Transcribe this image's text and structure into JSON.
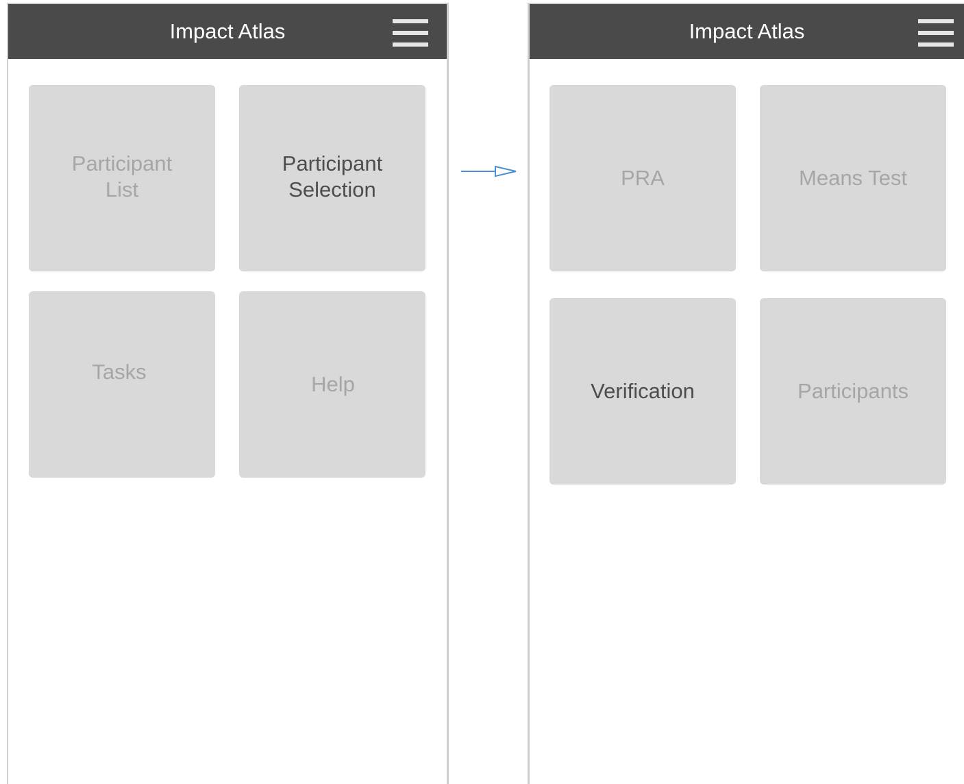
{
  "screens": [
    {
      "header": {
        "title": "Impact Atlas"
      },
      "tiles": [
        {
          "label": "Participant\nList",
          "active": false
        },
        {
          "label": "Participant\nSelection",
          "active": true
        },
        {
          "label": "Tasks",
          "active": false
        },
        {
          "label": "Help",
          "active": false
        }
      ]
    },
    {
      "header": {
        "title": "Impact Atlas"
      },
      "tiles": [
        {
          "label": "PRA",
          "active": false
        },
        {
          "label": "Means Test",
          "active": false
        },
        {
          "label": "Verification",
          "active": true
        },
        {
          "label": "Participants",
          "active": false
        }
      ]
    }
  ],
  "colors": {
    "header_bg": "#4a4a4a",
    "tile_bg": "#d9d9d9",
    "label_inactive": "#a6a6a6",
    "label_active": "#4d4d4d",
    "arrow": "#4a90d9"
  },
  "icons": {
    "menu": "hamburger-menu-icon",
    "flow": "right-arrow-icon"
  }
}
